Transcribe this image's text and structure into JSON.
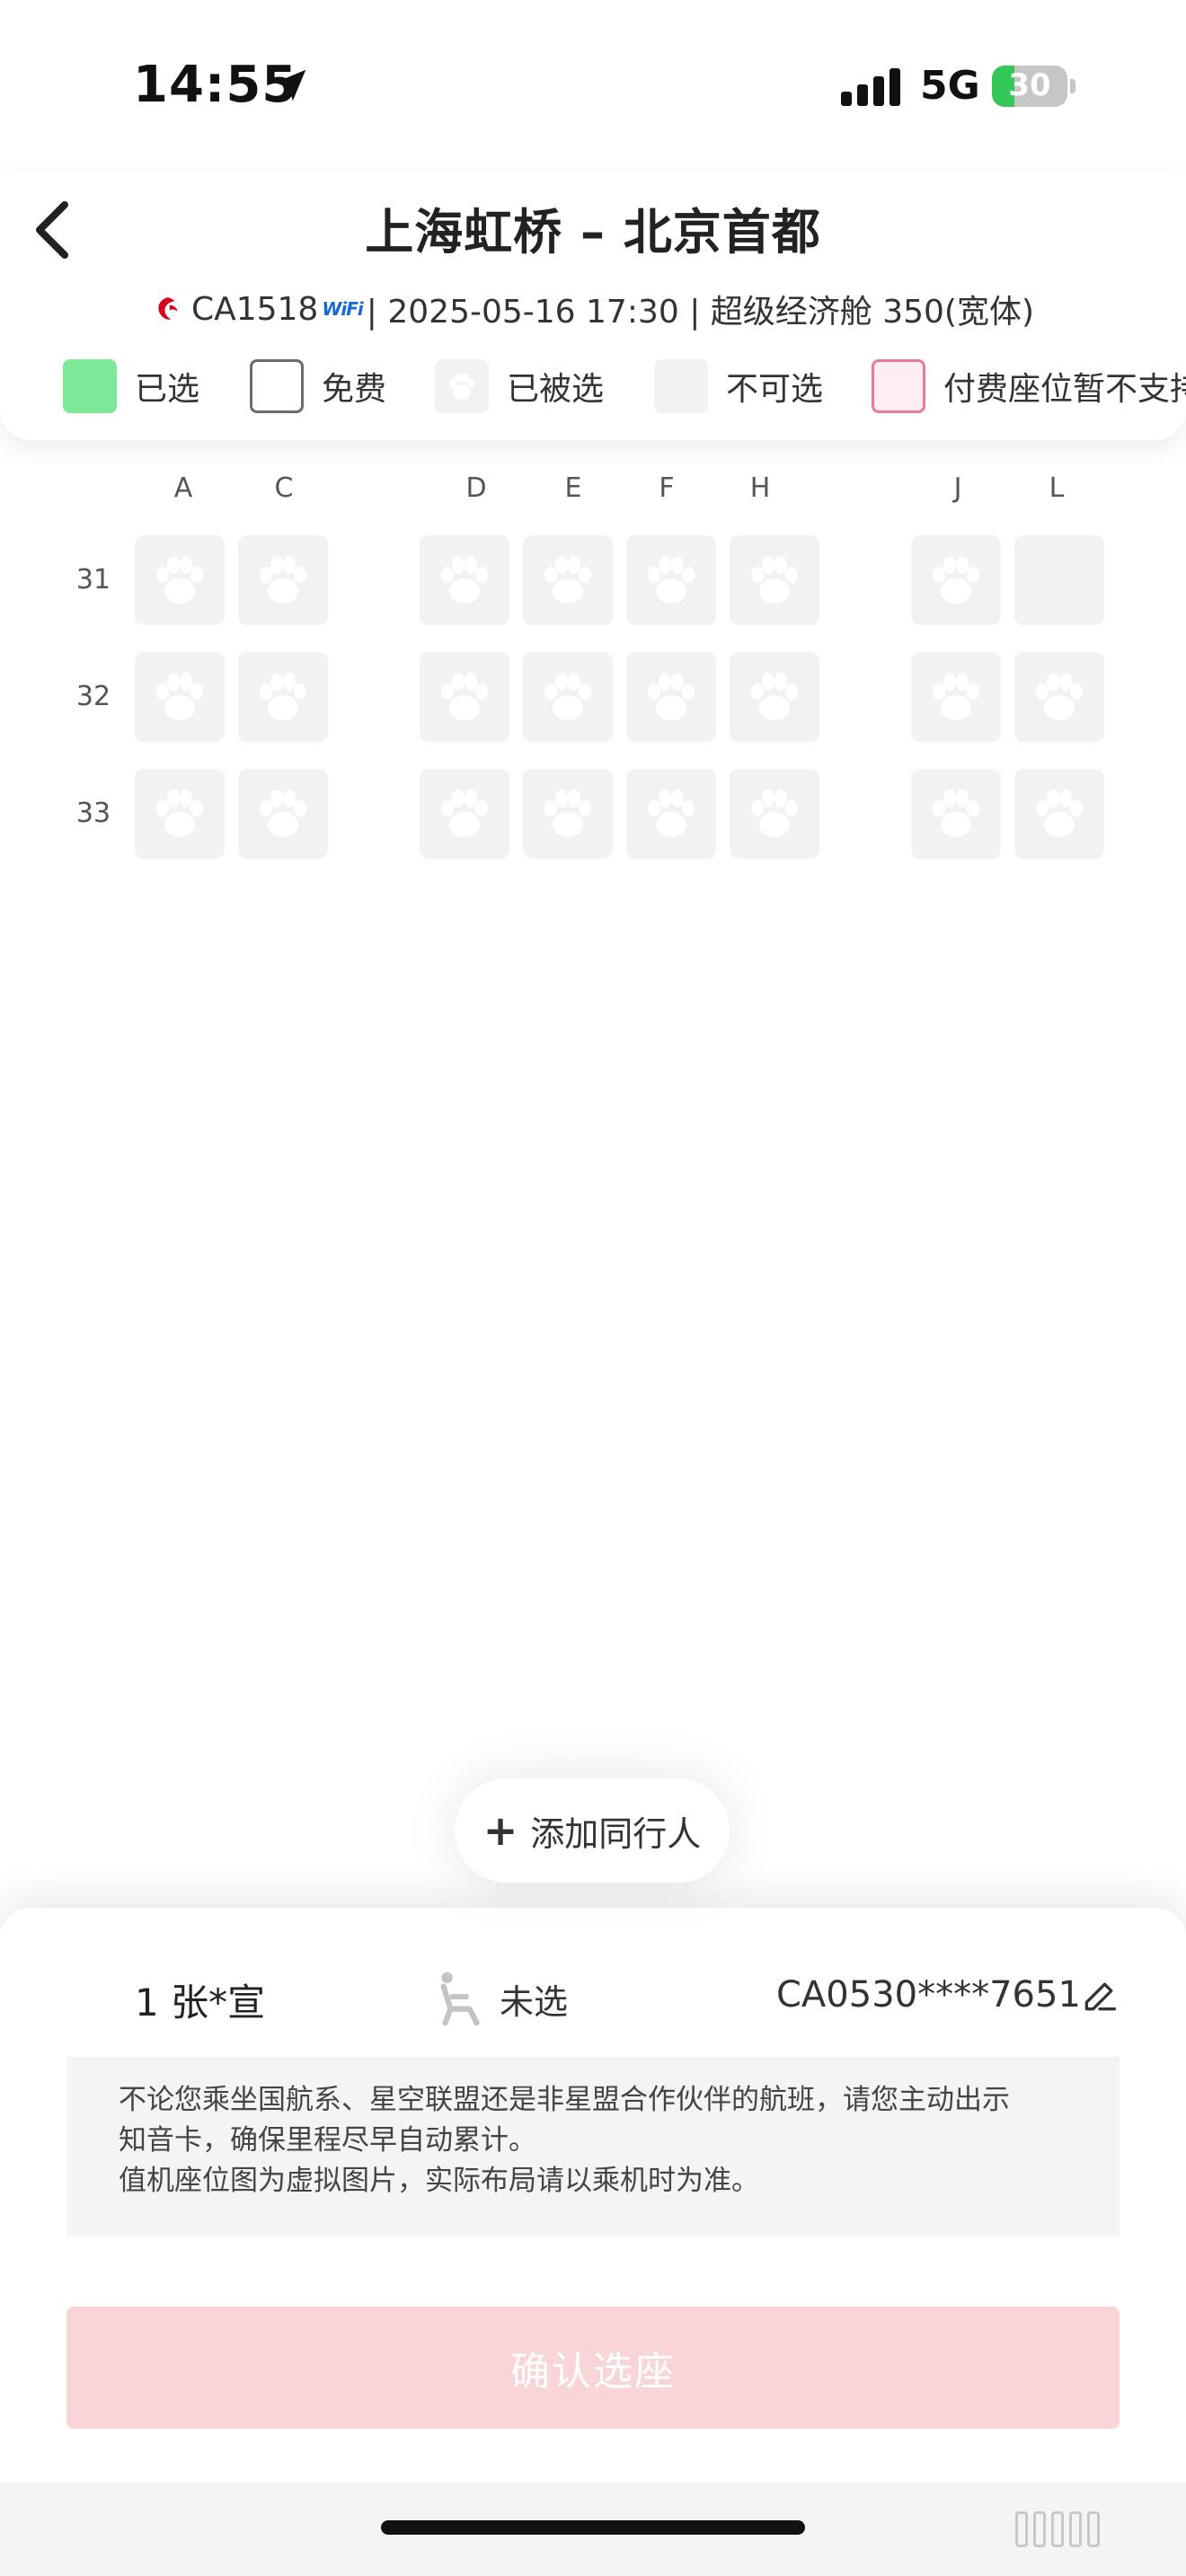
{
  "status_bar": {
    "time": "14:55",
    "network": "5G",
    "battery_level": "30",
    "battery_fraction": 0.3
  },
  "header": {
    "route_title": "上海虹桥 – 北京首都",
    "flight_number": "CA1518",
    "wifi_label": "WiFi",
    "flight_details": " | 2025-05-16 17:30 | 超级经济舱 350(宽体)"
  },
  "legend": {
    "items": [
      {
        "label": "已选",
        "swatch": "selected",
        "color": "#7ee89a"
      },
      {
        "label": "免费",
        "swatch": "free",
        "color": "#ffffff"
      },
      {
        "label": "已被选",
        "swatch": "taken",
        "color": "#f2f2f4"
      },
      {
        "label": "不可选",
        "swatch": "unavailable",
        "color": "#f2f2f4"
      },
      {
        "label": "付费座位暂不支持",
        "swatch": "paid",
        "color": "#fdeef2"
      }
    ]
  },
  "seat_map": {
    "columns": [
      "A",
      "C",
      "D",
      "E",
      "F",
      "H",
      "J",
      "L"
    ],
    "rows": [
      {
        "number": "31",
        "seats": [
          "taken",
          "taken",
          "taken",
          "taken",
          "taken",
          "taken",
          "taken",
          "unavailable"
        ]
      },
      {
        "number": "32",
        "seats": [
          "taken",
          "taken",
          "taken",
          "taken",
          "taken",
          "taken",
          "taken",
          "taken"
        ]
      },
      {
        "number": "33",
        "seats": [
          "taken",
          "taken",
          "taken",
          "taken",
          "taken",
          "taken",
          "taken",
          "taken"
        ]
      }
    ]
  },
  "add_companion": {
    "plus": "+",
    "label": "添加同行人"
  },
  "passenger": {
    "name": "1 张*宣",
    "seat_status": "未选",
    "card_number": "CA0530****7651"
  },
  "notice": {
    "lines": [
      "不论您乘坐国航系、星空联盟还是非星盟合作伙伴的航班，请您主动出示",
      "知音卡，确保里程尽早自动累计。",
      "值机座位图为虚拟图片，实际布局请以乘机时为准。"
    ]
  },
  "confirm_button": {
    "label": "确认选座"
  },
  "colors": {
    "selected_green": "#7ee89a",
    "paid_pink_border": "#e87a9c",
    "confirm_disabled": "#fad5d7",
    "battery_green": "#34c759"
  }
}
